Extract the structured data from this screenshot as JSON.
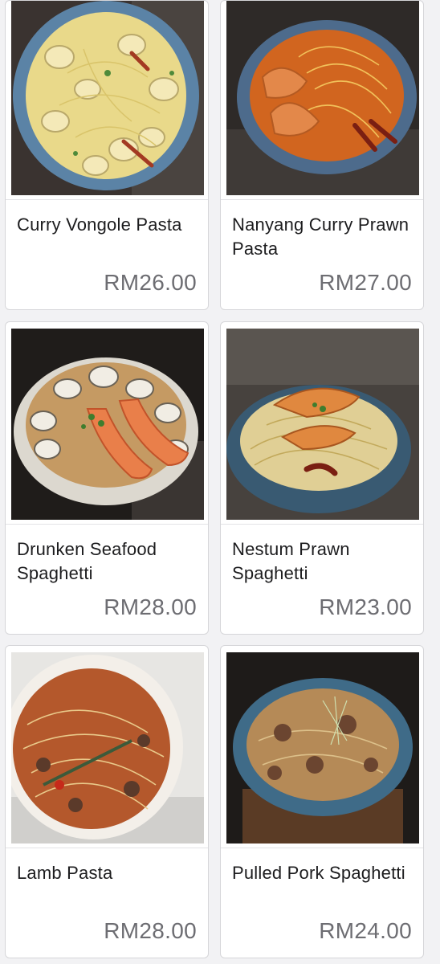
{
  "menu": {
    "items": [
      {
        "name": "Curry Vongole Pasta",
        "price": "RM26.00",
        "photo_icon": "curry-vongole-photo"
      },
      {
        "name": "Nanyang Curry Prawn Pasta",
        "price": "RM27.00",
        "photo_icon": "nanyang-curry-prawn-photo"
      },
      {
        "name": "Drunken Seafood Spaghetti",
        "price": "RM28.00",
        "photo_icon": "drunken-seafood-photo"
      },
      {
        "name": "Nestum Prawn Spaghetti",
        "price": "RM23.00",
        "photo_icon": "nestum-prawn-photo"
      },
      {
        "name": "Lamb Pasta",
        "price": "RM28.00",
        "photo_icon": "lamb-pasta-photo"
      },
      {
        "name": "Pulled Pork Spaghetti",
        "price": "RM24.00",
        "photo_icon": "pulled-pork-photo"
      }
    ]
  },
  "colors": {
    "page_bg": "#f2f2f4",
    "card_bg": "#ffffff",
    "card_border": "#d6d6d9",
    "name_text": "#1c1c1e",
    "price_text": "#6d6d72"
  }
}
